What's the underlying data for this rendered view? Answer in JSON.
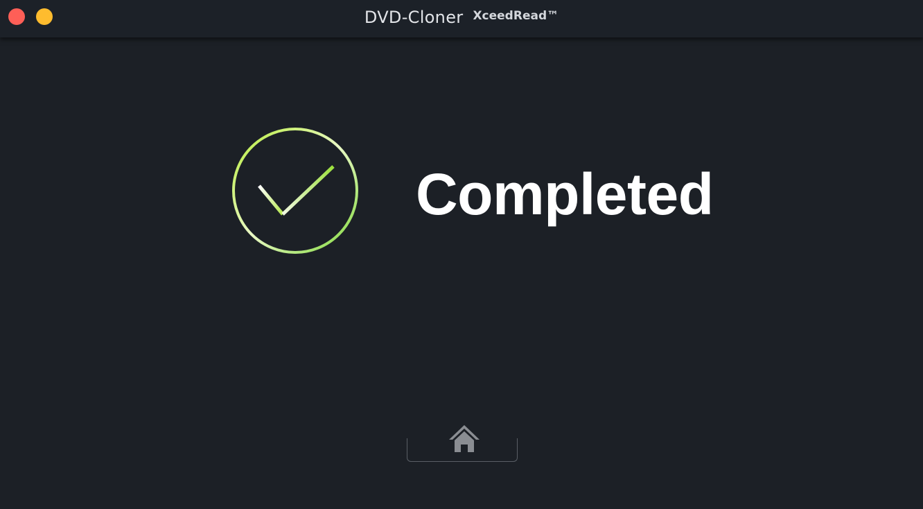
{
  "window": {
    "app_name": "DVD-Cloner",
    "brand_tag": "XceedRead™"
  },
  "status": {
    "message": "Completed",
    "icon": "check-circle-icon",
    "accent_color": "#a6e635"
  },
  "footer": {
    "home_icon": "home-icon"
  },
  "colors": {
    "background": "#1c2026",
    "close": "#fe5f57",
    "minimize": "#febc2e"
  }
}
